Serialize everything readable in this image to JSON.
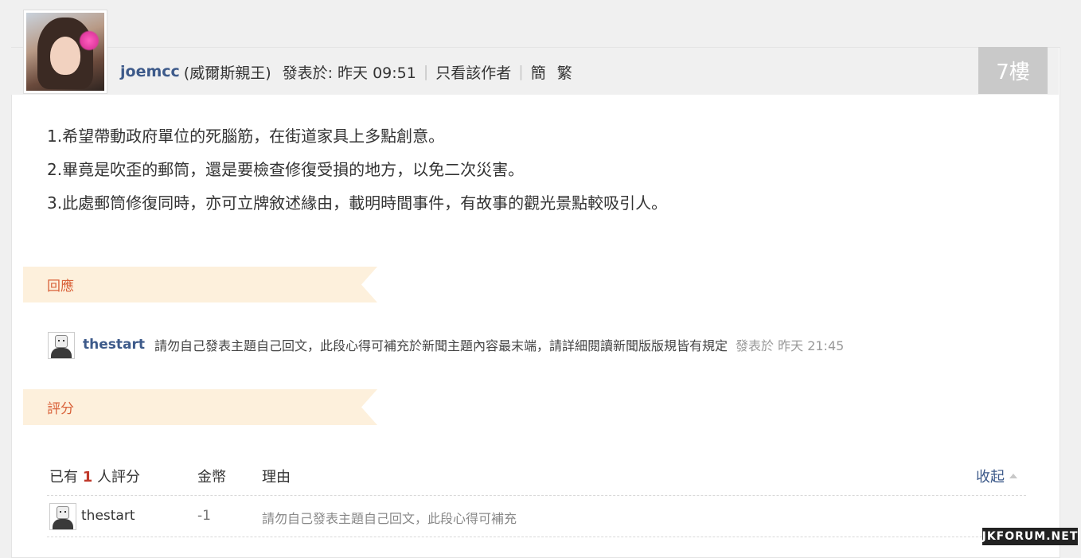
{
  "post": {
    "author": "joemcc",
    "author_title": "(威爾斯親王)",
    "posted": "發表於: 昨天 09:51",
    "only_author_link": "只看該作者",
    "simplified": "簡",
    "traditional": "繁",
    "floor": "7樓",
    "lines": [
      "1.希望帶動政府單位的死腦筋，在街道家具上多點創意。",
      "2.畢竟是吹歪的郵筒，還是要檢查修復受損的地方，以免二次災害。",
      "3.此處郵筒修復同時，亦可立牌敘述緣由，載明時間事件，有故事的觀光景點較吸引人。"
    ]
  },
  "replies": {
    "heading": "回應",
    "item": {
      "user": "thestart",
      "message": "請勿自己發表主題自己回文，此段心得可補充於新聞主題內容最末端，請詳細閱讀新聞版版規皆有規定",
      "time": "發表於 昨天 21:45"
    }
  },
  "ratings": {
    "heading": "評分",
    "summary_prefix": "已有",
    "count": "1",
    "summary_suffix": "人評分",
    "col_coins": "金幣",
    "col_reason": "理由",
    "collapse": "收起",
    "rows": [
      {
        "user": "thestart",
        "coins": "-1",
        "reason": "請勿自己發表主題自己回文，此段心得可補充"
      }
    ]
  },
  "watermark": "JKFORUM.NET",
  "icons": {
    "author_avatar": "user-avatar-photo",
    "reply_avatar": "default-avatar-icon",
    "collapse": "triangle-up-icon"
  },
  "colors": {
    "author_link": "#3d5a8a",
    "section_bar": "#fdf0dc",
    "section_text": "#d9623a",
    "floor_badge": "#c9c9c9",
    "rating_count": "#c0392b"
  }
}
